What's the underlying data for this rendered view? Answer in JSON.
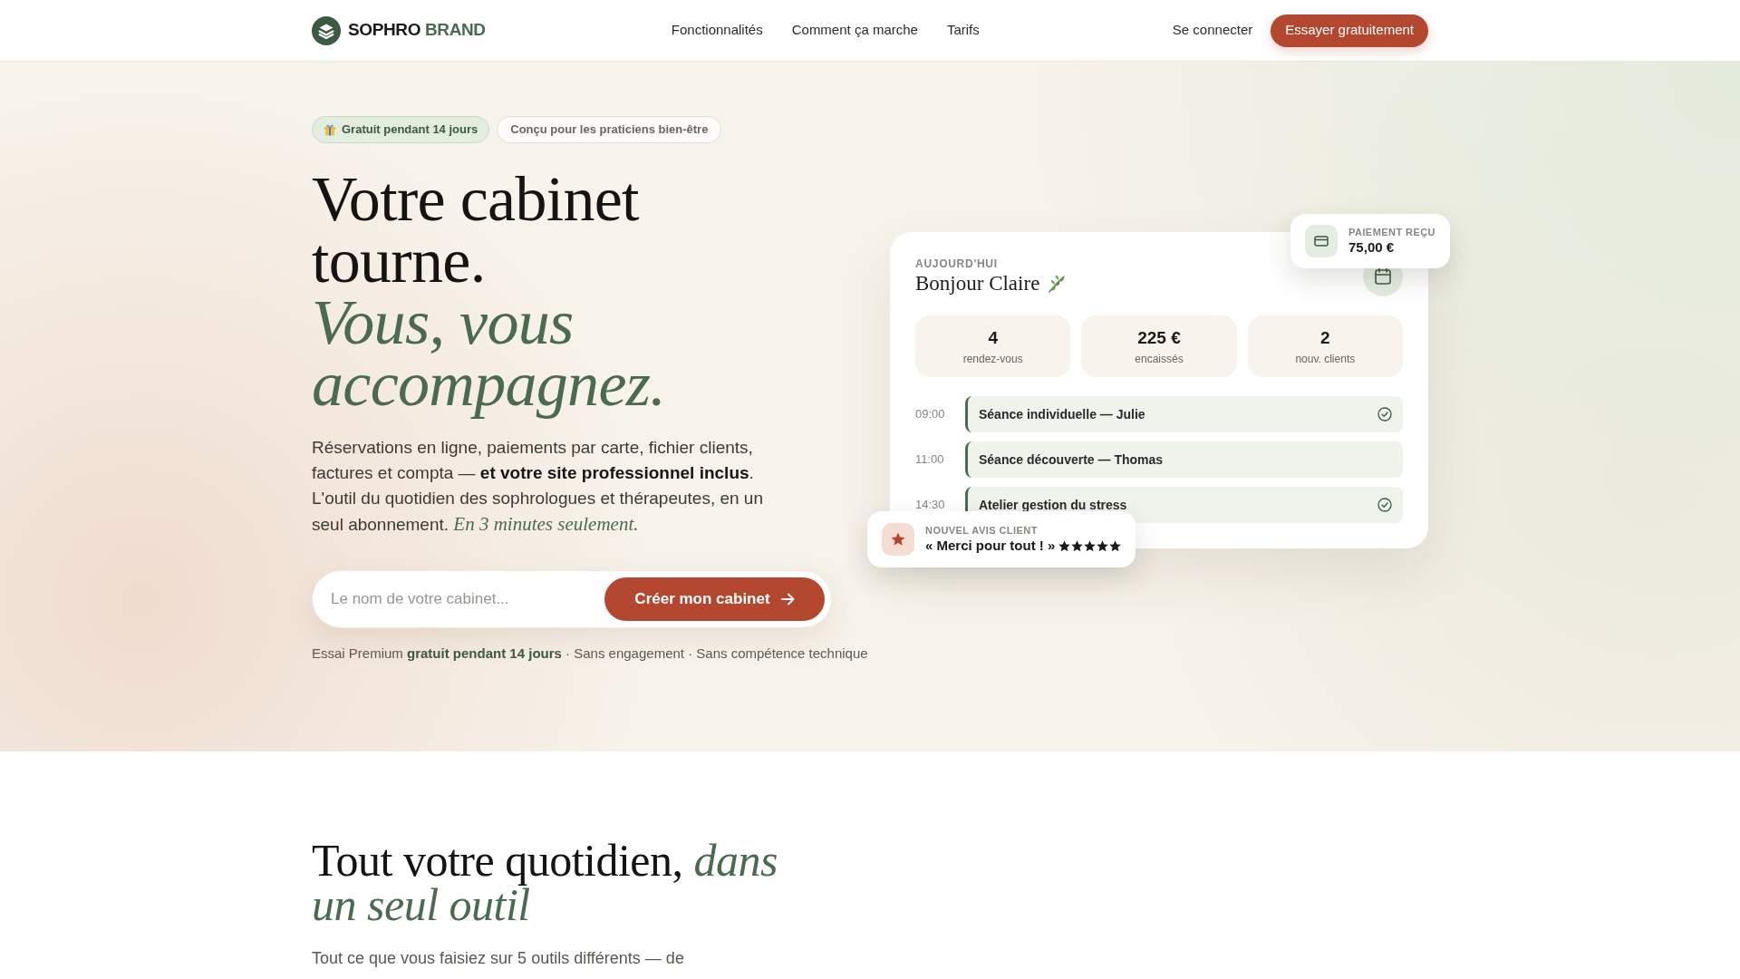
{
  "header": {
    "logo": {
      "name": "SOPHRO",
      "accent": "BRAND"
    },
    "nav": [
      "Fonctionnalités",
      "Comment ça marche",
      "Tarifs"
    ],
    "login": "Se connecter",
    "cta": "Essayer gratuitement"
  },
  "hero": {
    "badges": [
      {
        "kind": "highlight",
        "label": "Gratuit pendant 14 jours"
      },
      {
        "kind": "outline",
        "label": "Conçu pour les praticiens bien-être"
      }
    ],
    "title": "Votre cabinet tourne. *Vous, vous accompagnez.*",
    "description": "Réservations en ligne, paiements par carte, fichier clients, factures et compta — **et votre site professionnel inclus**. L'outil du quotidien des sophrologues et thérapeutes, en un seul abonnement. *En 3 minutes seulement.*",
    "signup": {
      "placeholder": "Le nom de votre cabinet...",
      "button": "Créer mon cabinet"
    },
    "note": "Essai Premium **gratuit pendant 14 jours** · Sans engagement · Sans compétence technique"
  },
  "dashboard": {
    "eyebrow": "AUJOURD'HUI",
    "greeting": "Bonjour Claire",
    "stats": [
      {
        "value": "4",
        "label": "rendez-vous"
      },
      {
        "value": "225 €",
        "label": "encaissés"
      },
      {
        "value": "2",
        "label": "nouv. clients"
      }
    ],
    "schedule": [
      {
        "time": "09:00",
        "title": "Séance individuelle — Julie",
        "done": true
      },
      {
        "time": "11:00",
        "title": "Séance découverte — Thomas",
        "done": false
      },
      {
        "time": "14:30",
        "title": "Atelier gestion du stress",
        "done": true
      }
    ],
    "payment_toast": {
      "label": "PAIEMENT REÇU",
      "amount": "75,00 €"
    },
    "review_toast": {
      "label": "NOUVEL AVIS CLIENT",
      "quote": "« Merci pour tout ! »",
      "stars": 5
    }
  },
  "features": {
    "title": "Tout votre quotidien, *dans un seul outil*",
    "description": "Tout ce que vous faisiez sur 5 outils différents — de"
  }
}
